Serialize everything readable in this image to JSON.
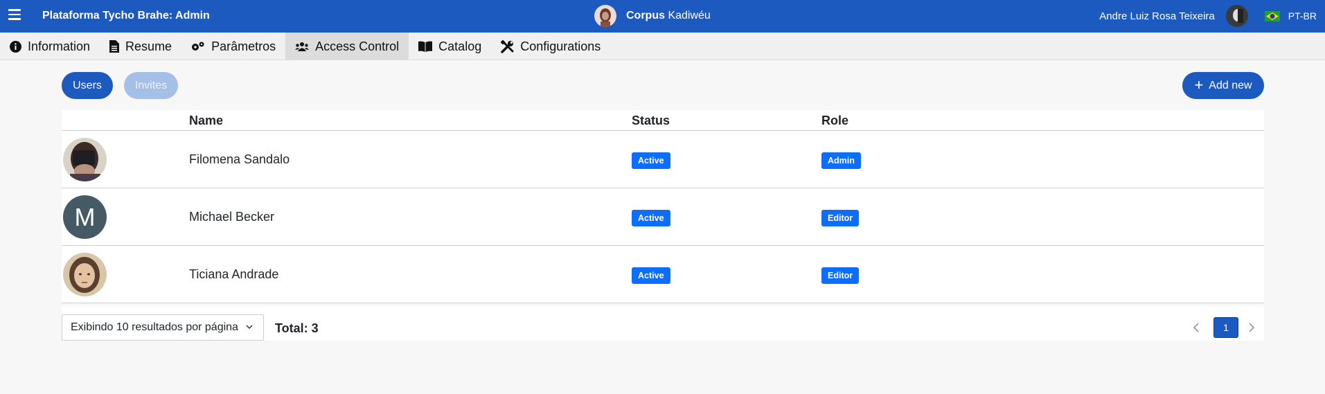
{
  "header": {
    "app_title": "Plataforma Tycho Brahe: Admin",
    "corpus_label": "Corpus",
    "corpus_name": "Kadiwéu",
    "user_name": "Andre Luiz Rosa Teixeira",
    "language": "PT-BR",
    "icons": [
      "hamburger-icon",
      "brazil-flag-icon"
    ]
  },
  "tabs": [
    {
      "label": "Information",
      "icon": "info-icon"
    },
    {
      "label": "Resume",
      "icon": "document-icon"
    },
    {
      "label": "Parâmetros",
      "icon": "gears-icon"
    },
    {
      "label": "Access Control",
      "icon": "users-icon",
      "active": true
    },
    {
      "label": "Catalog",
      "icon": "book-icon"
    },
    {
      "label": "Configurations",
      "icon": "tools-icon"
    }
  ],
  "toolbar": {
    "users_label": "Users",
    "invites_label": "Invites",
    "add_new_label": "Add new"
  },
  "table": {
    "columns": [
      "Name",
      "Status",
      "Role"
    ],
    "rows": [
      {
        "name": "Filomena Sandalo",
        "status": "Active",
        "role": "Admin",
        "avatar": "photo"
      },
      {
        "name": "Michael Becker",
        "status": "Active",
        "role": "Editor",
        "avatar_letter": "M"
      },
      {
        "name": "Ticiana Andrade",
        "status": "Active",
        "role": "Editor",
        "avatar": "photo"
      }
    ]
  },
  "footer": {
    "per_page_label": "Exibindo 10 resultados por página",
    "total_label": "Total: 3",
    "current_page": "1"
  },
  "colors": {
    "primary": "#1c5ac0",
    "badge": "#0d6efd",
    "background": "#f7f7f7"
  }
}
